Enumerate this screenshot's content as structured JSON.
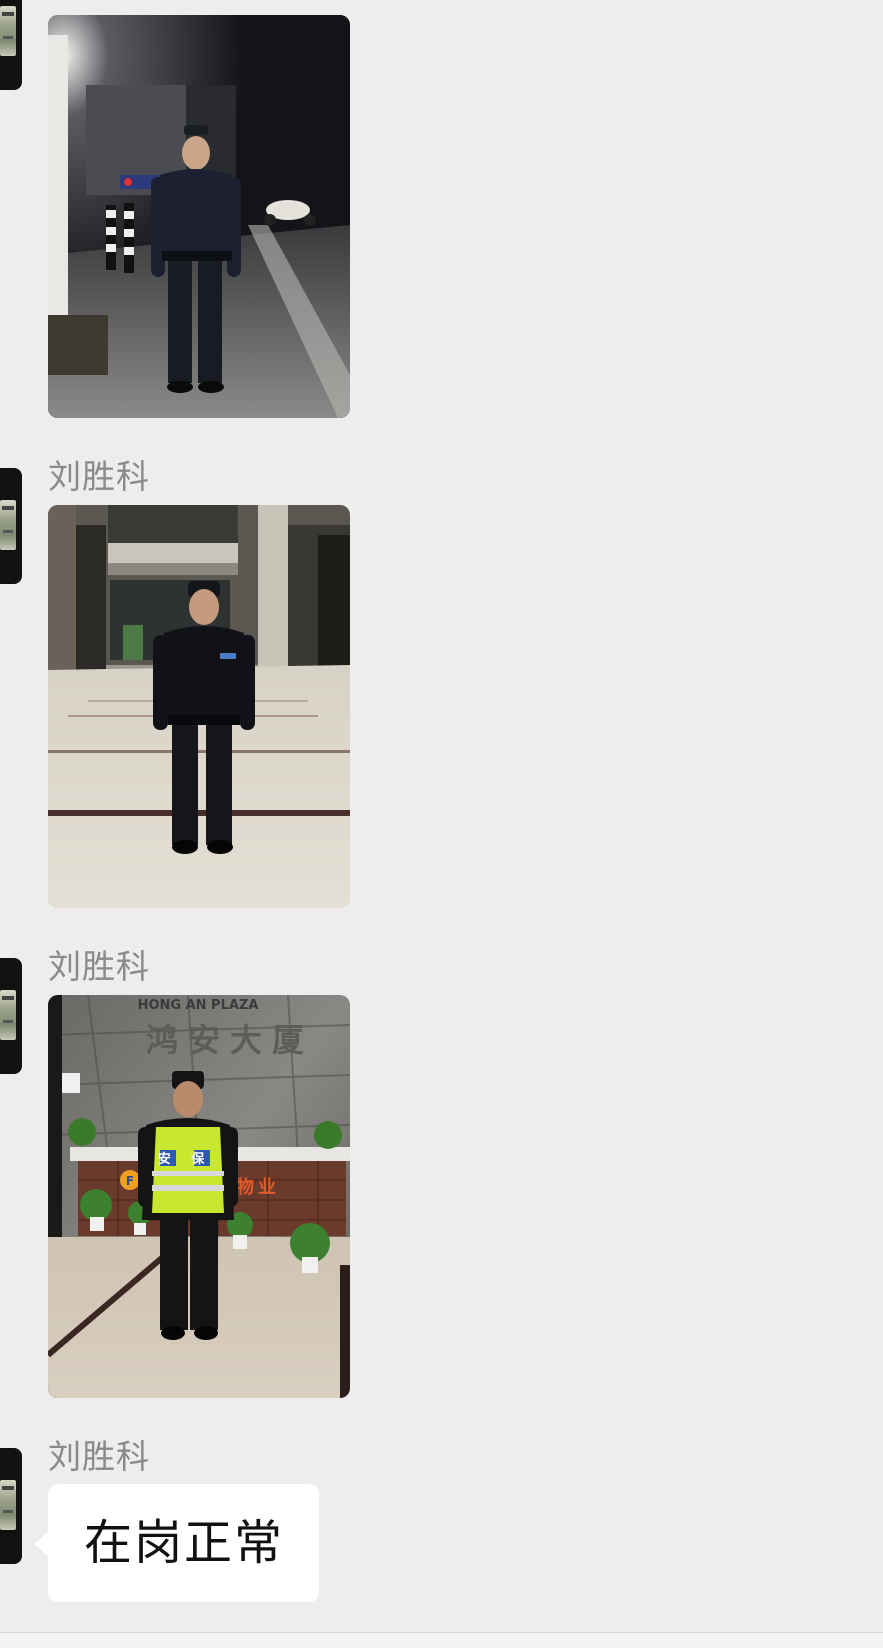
{
  "chat": {
    "messages": [
      {
        "type": "image",
        "sender": "",
        "photo_label": "guard-at-parking-entrance-night"
      },
      {
        "type": "image",
        "sender": "刘胜科",
        "photo_label": "guard-in-lobby"
      },
      {
        "type": "image",
        "sender": "刘胜科",
        "photo_label": "guard-with-vest-at-reception",
        "sign_text": "鸿安大厦",
        "sign_latin": "HONG AN PLAZA",
        "vest_text": "安 保",
        "desk_text": "物业"
      },
      {
        "type": "text",
        "sender": "刘胜科",
        "text": "在岗正常"
      }
    ]
  },
  "colors": {
    "background": "#ededed",
    "bubble": "#ffffff",
    "sender_name": "#8a8a8a"
  }
}
